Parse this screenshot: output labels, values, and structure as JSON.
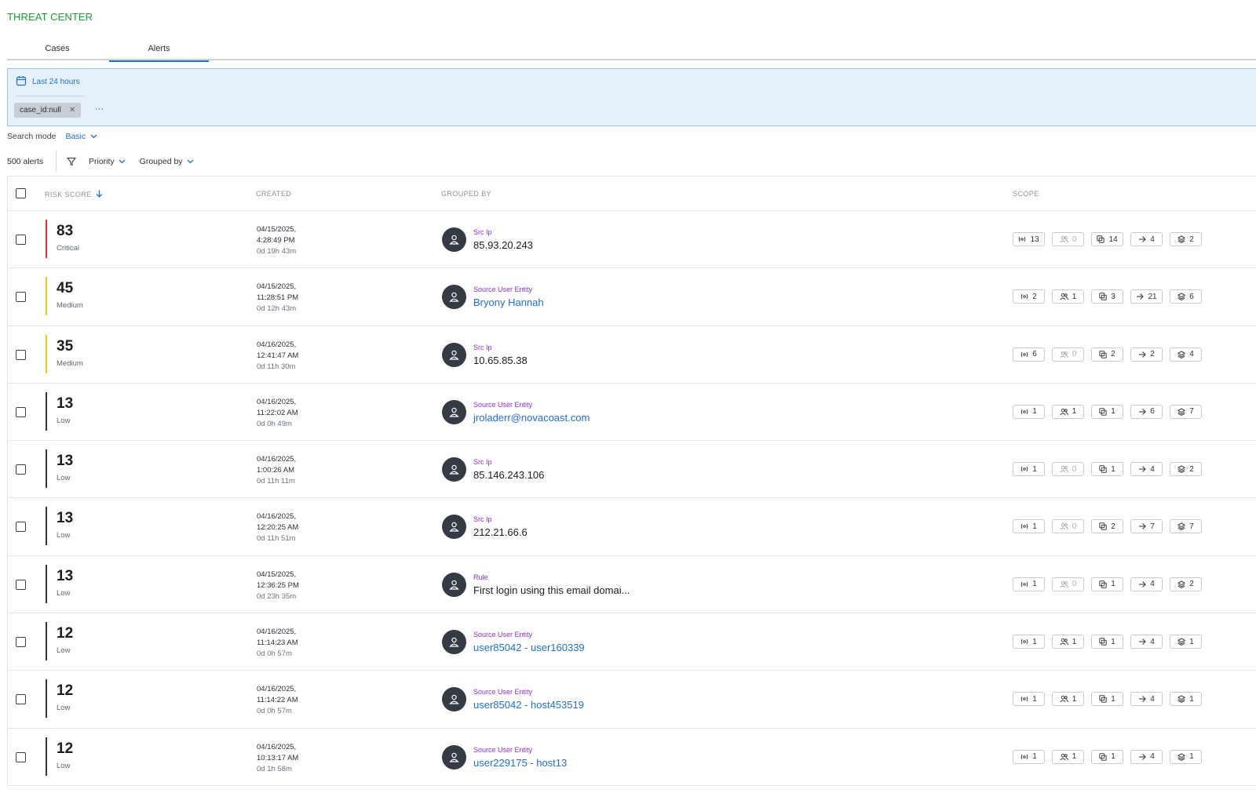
{
  "app": {
    "title": "THREAT CENTER"
  },
  "tabs": [
    {
      "label": "Cases",
      "active": false
    },
    {
      "label": "Alerts",
      "active": true
    }
  ],
  "filter_bar": {
    "date_range": "Last 24 hours",
    "chips": [
      {
        "label": "case_id:null"
      }
    ],
    "more": "···"
  },
  "search_mode": {
    "label": "Search mode",
    "value": "Basic"
  },
  "toolbar": {
    "alert_count": "500 alerts",
    "priority_label": "Priority",
    "grouped_by_label": "Grouped by"
  },
  "table": {
    "columns": {
      "risk_score": "RISK SCORE",
      "created": "CREATED",
      "grouped_by": "GROUPED BY",
      "scope": "SCOPE"
    },
    "rows": [
      {
        "score": "83",
        "severity": "Critical",
        "date": "04/15/2025,",
        "time": "4:28:49 PM",
        "ago": "0d 19h 43m",
        "type": "Src Ip",
        "value": "85.93.20.243",
        "link": false,
        "scope": [
          "13",
          "0",
          "14",
          "4",
          "2"
        ]
      },
      {
        "score": "45",
        "severity": "Medium",
        "date": "04/15/2025,",
        "time": "11:28:51 PM",
        "ago": "0d 12h 43m",
        "type": "Source User Entity",
        "value": "Bryony Hannah",
        "link": true,
        "scope": [
          "2",
          "1",
          "3",
          "21",
          "6"
        ]
      },
      {
        "score": "35",
        "severity": "Medium",
        "date": "04/16/2025,",
        "time": "12:41:47 AM",
        "ago": "0d 11h 30m",
        "type": "Src Ip",
        "value": "10.65.85.38",
        "link": false,
        "scope": [
          "6",
          "0",
          "2",
          "2",
          "4"
        ]
      },
      {
        "score": "13",
        "severity": "Low",
        "date": "04/16/2025,",
        "time": "11:22:02 AM",
        "ago": "0d 0h 49m",
        "type": "Source User Entity",
        "value": "jroladerr@novacoast.com",
        "link": true,
        "scope": [
          "1",
          "1",
          "1",
          "6",
          "7"
        ]
      },
      {
        "score": "13",
        "severity": "Low",
        "date": "04/16/2025,",
        "time": "1:00:26 AM",
        "ago": "0d 11h 11m",
        "type": "Src Ip",
        "value": "85.146.243.106",
        "link": false,
        "scope": [
          "1",
          "0",
          "1",
          "4",
          "2"
        ]
      },
      {
        "score": "13",
        "severity": "Low",
        "date": "04/16/2025,",
        "time": "12:20:25 AM",
        "ago": "0d 11h 51m",
        "type": "Src Ip",
        "value": "212.21.66.6",
        "link": false,
        "scope": [
          "1",
          "0",
          "2",
          "7",
          "7"
        ]
      },
      {
        "score": "13",
        "severity": "Low",
        "date": "04/15/2025,",
        "time": "12:36:25 PM",
        "ago": "0d 23h 35m",
        "type": "Rule",
        "value": "First login using this email domai...",
        "link": false,
        "scope": [
          "1",
          "0",
          "1",
          "4",
          "2"
        ]
      },
      {
        "score": "12",
        "severity": "Low",
        "date": "04/16/2025,",
        "time": "11:14:23 AM",
        "ago": "0d 0h 57m",
        "type": "Source User Entity",
        "value": "user85042 - user160339",
        "link": true,
        "scope": [
          "1",
          "1",
          "1",
          "4",
          "1"
        ]
      },
      {
        "score": "12",
        "severity": "Low",
        "date": "04/16/2025,",
        "time": "11:14:22 AM",
        "ago": "0d 0h 57m",
        "type": "Source User Entity",
        "value": "user85042 - host453519",
        "link": true,
        "scope": [
          "1",
          "1",
          "1",
          "4",
          "1"
        ]
      },
      {
        "score": "12",
        "severity": "Low",
        "date": "04/16/2025,",
        "time": "10:13:17 AM",
        "ago": "0d 1h 58m",
        "type": "Source User Entity",
        "value": "user229175 - host13",
        "link": true,
        "scope": [
          "1",
          "1",
          "1",
          "4",
          "1"
        ]
      }
    ]
  },
  "colors": {
    "brand": "#1a9c2e",
    "accent": "#1e6fd9",
    "critical": "#e0312f",
    "medium": "#f5c518",
    "low": "#2f3640",
    "group_type": "#8b2fd6"
  },
  "icons": {
    "scope": [
      "signal-icon",
      "users-icon",
      "copy-icon",
      "arrow-right-icon",
      "layers-icon"
    ],
    "avatar": "user-icon",
    "date": "calendar-icon",
    "filter": "funnel-icon",
    "sort": "arrow-down-icon"
  }
}
